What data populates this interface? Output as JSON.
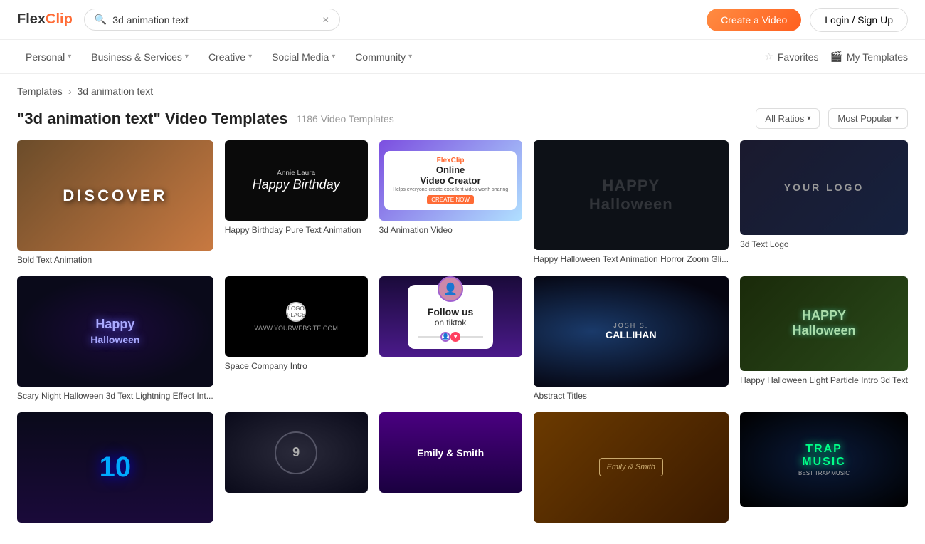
{
  "header": {
    "logo": "FlexClip",
    "search_value": "3d animation text",
    "create_btn": "Create a Video",
    "login_btn": "Login / Sign Up"
  },
  "nav": {
    "items": [
      {
        "label": "Personal",
        "has_dropdown": true
      },
      {
        "label": "Business & Services",
        "has_dropdown": true
      },
      {
        "label": "Creative",
        "has_dropdown": true
      },
      {
        "label": "Social Media",
        "has_dropdown": true
      },
      {
        "label": "Community",
        "has_dropdown": true
      }
    ],
    "favorites_label": "Favorites",
    "my_templates_label": "My Templates"
  },
  "breadcrumb": {
    "root": "Templates",
    "current": "3d animation text"
  },
  "page": {
    "title_prefix": "\"3d animation text\"",
    "title_suffix": " Video Templates",
    "result_count": "1186 Video Templates",
    "filter_ratio": "All Ratios",
    "filter_sort": "Most Popular"
  },
  "templates": [
    {
      "label": "Bold Text Animation"
    },
    {
      "label": "Happy Birthday Pure Text Animation"
    },
    {
      "label": "3d Animation Video"
    },
    {
      "label": "Happy Halloween Text Animation Horror Zoom Gli..."
    },
    {
      "label": "3d Text Logo"
    },
    {
      "label": "Scary Night Halloween 3d Text Lightning Effect Int..."
    },
    {
      "label": "Space Company Intro"
    },
    {
      "label": ""
    },
    {
      "label": "Abstract Titles"
    },
    {
      "label": "Happy Halloween Light Particle Intro 3d Text"
    },
    {
      "label": ""
    },
    {
      "label": ""
    },
    {
      "label": ""
    }
  ]
}
